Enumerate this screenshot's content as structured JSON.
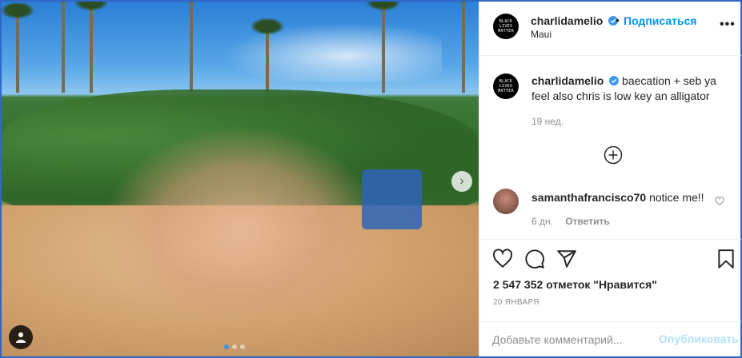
{
  "photo": {
    "alt_elements": [
      "palm-trees",
      "hedge",
      "beach-sand",
      "group-of-friends",
      "beach-chair"
    ],
    "carousel_dots": 3,
    "active_dot": 0,
    "next_icon": "chevron-right-icon",
    "user_tag_icon": "person-icon"
  },
  "header": {
    "avatar_text": "BLACK LIVES MATTER",
    "username": "charlidamelio",
    "separator": "•",
    "follow_label": "Подписаться",
    "location": "Maui",
    "more_icon": "more-options-icon"
  },
  "caption": {
    "avatar_text": "BLACK LIVES MATTER",
    "username": "charlidamelio",
    "text": "baecation + seb ya feel also chris is low key an alligator",
    "time": "19 нед."
  },
  "load_more_icon": "plus-circle-icon",
  "comment": {
    "username": "samanthafrancisco70",
    "text": "notice me!!",
    "time": "6 дн.",
    "reply_label": "Ответить"
  },
  "actions": {
    "likes": "2 547 352 отметок \"Нравится\"",
    "date": "20 ЯНВАРЯ"
  },
  "add_comment": {
    "placeholder": "Добавьте комментарий...",
    "post_label": "Опубликовать"
  },
  "colors": {
    "accent": "#0095f6",
    "post_disabled": "#b2dffc",
    "muted_text": "#8e8e8e",
    "border": "#efefef",
    "frame": "#2f67c9"
  }
}
